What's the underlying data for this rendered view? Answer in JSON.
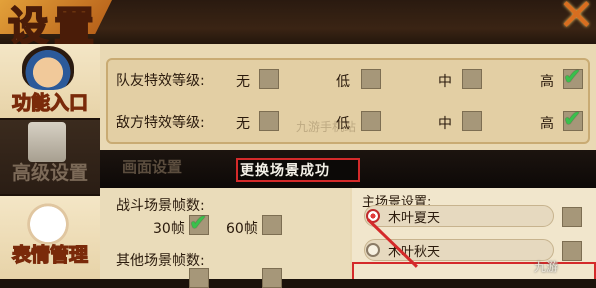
{
  "header": {
    "title": "设置",
    "close_glyph": "✕",
    "watermark": ""
  },
  "sidebar": {
    "tabs": [
      {
        "label": "功能入口",
        "icon": "ninja-avatar-icon",
        "active": true
      },
      {
        "label": "高级设置",
        "icon": "scroll-icon",
        "active": false
      },
      {
        "label": "表情管理",
        "icon": "face-avatar-icon",
        "active": true
      }
    ]
  },
  "effects": {
    "rows": [
      {
        "label": "队友特效等级:",
        "options": [
          "无",
          "低",
          "中",
          "高"
        ],
        "checked": "高"
      },
      {
        "label": "敌方特效等级:",
        "options": [
          "无",
          "低",
          "中",
          "高"
        ],
        "checked": "高"
      }
    ],
    "watermark_mid": "九游手机站"
  },
  "section": {
    "tab_label": "画面设置",
    "toast": "更换场景成功",
    "toast_border_color": "#d42a2a"
  },
  "battle_fps": {
    "label": "战斗场景帧数:",
    "options": [
      "30帧",
      "60帧"
    ],
    "checked": "30帧"
  },
  "other_fps": {
    "label": "其他场景帧数:"
  },
  "main_scene": {
    "label": "主场景设置:",
    "options": [
      "木叶夏天",
      "木叶秋天"
    ],
    "selected": "木叶夏天"
  },
  "watermark_corner": "九游"
}
